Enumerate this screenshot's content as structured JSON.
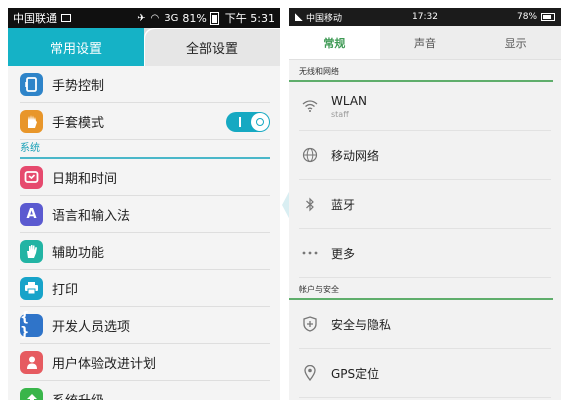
{
  "left": {
    "status": {
      "carrier": "中国联通",
      "signal_text": "3G",
      "battery_pct": "81%",
      "time": "下午 5:31"
    },
    "tabs": [
      {
        "label": "常用设置",
        "active": true
      },
      {
        "label": "全部设置",
        "active": false
      }
    ],
    "rows_top": [
      {
        "label": "手势控制",
        "icon": "gesture-icon",
        "glyph": "▯"
      },
      {
        "label": "手套模式",
        "icon": "glove-icon",
        "glyph": "✋",
        "toggle_on": true
      }
    ],
    "section_system": "系统",
    "rows_system": [
      {
        "label": "日期和时间",
        "icon": "calendar-clock-icon",
        "glyph": "⌚"
      },
      {
        "label": "语言和输入法",
        "icon": "language-icon",
        "glyph": "A"
      },
      {
        "label": "辅助功能",
        "icon": "accessibility-hand-icon",
        "glyph": "✋"
      },
      {
        "label": "打印",
        "icon": "printer-icon",
        "glyph": "⎙"
      },
      {
        "label": "开发人员选项",
        "icon": "developer-braces-icon",
        "glyph": "{ }"
      },
      {
        "label": "用户体验改进计划",
        "icon": "user-experience-icon",
        "glyph": "♟"
      },
      {
        "label": "系统升级",
        "icon": "update-icon",
        "glyph": "⇧"
      }
    ]
  },
  "right": {
    "status": {
      "carrier": "中国移动",
      "time": "17:32",
      "battery_pct": "78%"
    },
    "tabs": [
      {
        "label": "常规",
        "active": true
      },
      {
        "label": "声音",
        "active": false
      },
      {
        "label": "显示",
        "active": false
      }
    ],
    "section_wireless": "无线和网络",
    "rows_wireless": [
      {
        "title": "WLAN",
        "subtitle": "staff",
        "icon": "wifi-icon"
      },
      {
        "title": "移动网络",
        "icon": "globe-icon"
      },
      {
        "title": "蓝牙",
        "icon": "bluetooth-icon"
      },
      {
        "title": "更多",
        "icon": "more-dots-icon"
      }
    ],
    "section_account": "帐户与安全",
    "rows_account": [
      {
        "title": "安全与隐私",
        "icon": "shield-icon"
      },
      {
        "title": "GPS定位",
        "icon": "location-pin-icon"
      }
    ]
  }
}
